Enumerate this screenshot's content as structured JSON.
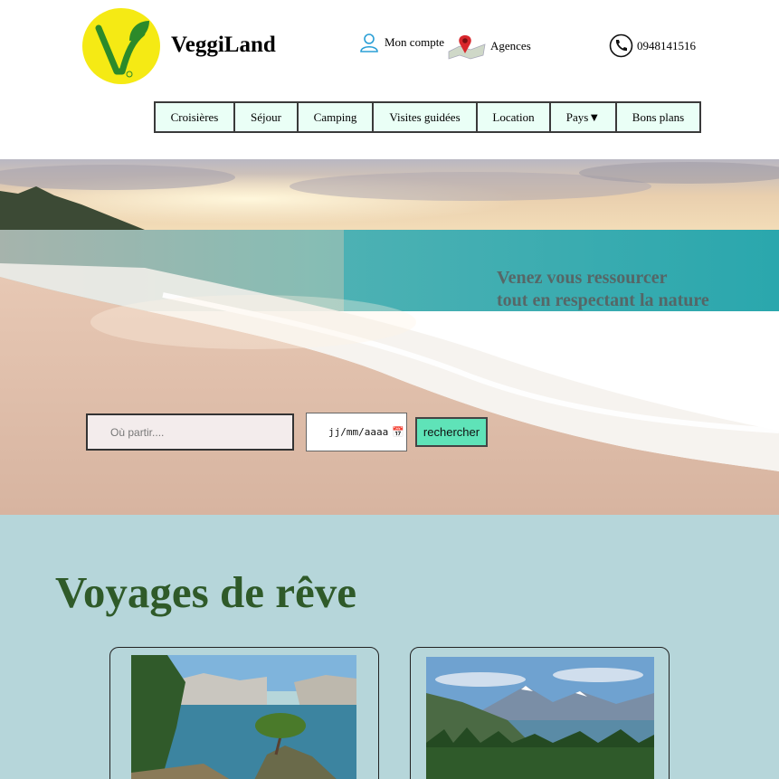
{
  "header": {
    "brand": "VeggiLand",
    "account_label": "Mon compte",
    "agences_label": "Agences",
    "phone": "0948141516"
  },
  "nav": [
    {
      "label": "Croisières"
    },
    {
      "label": "Séjour"
    },
    {
      "label": "Camping"
    },
    {
      "label": "Visites guidées"
    },
    {
      "label": "Location"
    },
    {
      "label": "Pays▼"
    },
    {
      "label": "Bons plans"
    }
  ],
  "hero": {
    "tagline_line1": "Venez vous ressourcer",
    "tagline_line2": "tout en respectant la nature",
    "search_placeholder": "Où partir....",
    "date_placeholder": "jj/mm/aaaa",
    "search_button": "rechercher"
  },
  "section": {
    "title": "Voyages de rêve"
  },
  "colors": {
    "logo_yellow": "#f5ea14",
    "nav_bg": "#eafff6",
    "button_bg": "#5fe3b8",
    "section_bg": "#b6d6da",
    "title_green": "#2f5a29"
  },
  "icons": [
    "veggie-logo-icon",
    "user-icon",
    "map-pin-icon",
    "phone-icon",
    "calendar-icon"
  ]
}
